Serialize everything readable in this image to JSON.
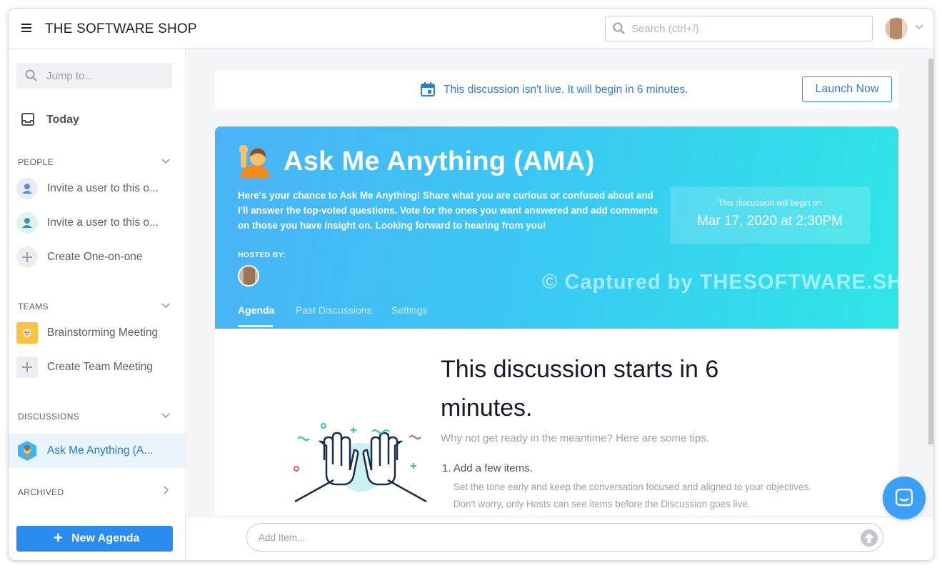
{
  "app": {
    "title": "THE SOFTWARE SHOP"
  },
  "search": {
    "placeholder": "Search (ctrl+/)"
  },
  "sidebar": {
    "jump_placeholder": "Jump to...",
    "today": "Today",
    "sections": {
      "people": "PEOPLE",
      "teams": "TEAMS",
      "discussions": "DISCUSSIONS",
      "archived": "ARCHIVED"
    },
    "people_items": [
      "Invite a user to this o...",
      "Invite a user to this o...",
      "Create One-on-one"
    ],
    "team_items": [
      "Brainstorming Meeting",
      "Create Team Meeting"
    ],
    "discussion_items": [
      "Ask Me Anything (A..."
    ],
    "new_agenda": "New Agenda",
    "colors": {
      "accent": "#2b8cf0",
      "active_bg": "#eaf4ff"
    }
  },
  "banner": {
    "message": "This discussion isn't live. It will begin in 6 minutes.",
    "launch_button": "Launch Now"
  },
  "hero": {
    "title": "Ask Me Anything (AMA)",
    "description": "Here's your chance to Ask Me Anything! Share what you are curious or confused about and I'll answer the top-voted questions. Vote for the ones you want answered and add comments on those you have insight on. Looking forward to hearing from you!",
    "begin_label": "This discussion will begin on",
    "begin_date": "Mar 17, 2020 at 2:30PM",
    "hosted_by": "HOSTED BY:",
    "watermark": "© Captured by THESOFTWARE.SHOP",
    "tabs": [
      "Agenda",
      "Past Discussions",
      "Settings"
    ],
    "active_tab": "Agenda"
  },
  "content": {
    "headline": "This discussion starts in 6 minutes.",
    "tips": "Why not get ready in the meantime? Here are some tips.",
    "step1_title": "1. Add a few items.",
    "step1_desc": "Set the tone early and keep the conversation focused and aligned to your objectives. Don't worry, only Hosts can see items before the Discussion goes live."
  },
  "composer": {
    "placeholder": "Add Item..."
  },
  "icons": [
    "hamburger-icon",
    "search-icon",
    "chevron-down-icon",
    "inbox-icon",
    "user-icon",
    "plus-icon",
    "calendar-icon",
    "raising-hand-icon",
    "send-arrow-icon",
    "chat-icon"
  ]
}
